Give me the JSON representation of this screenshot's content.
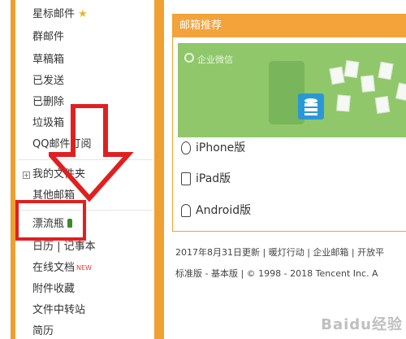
{
  "nav": {
    "items": [
      {
        "label": "星标邮件"
      },
      {
        "label": "群邮件"
      },
      {
        "label": "草稿箱"
      },
      {
        "label": "已发送"
      },
      {
        "label": "已删除"
      },
      {
        "label": "垃圾箱"
      },
      {
        "label": "QQ邮件订阅"
      },
      {
        "label": "我的文件夹"
      },
      {
        "label": "其他邮箱"
      },
      {
        "label": "漂流瓶"
      },
      {
        "label": "日历 | 记事本"
      },
      {
        "label": "在线文档",
        "badge": "NEW"
      },
      {
        "label": "附件收藏"
      },
      {
        "label": "文件中转站"
      },
      {
        "label": "简历"
      }
    ]
  },
  "panel": {
    "title": "邮箱推荐",
    "banner": {
      "title": "企业微信"
    },
    "platforms": [
      "iPhone版",
      "iPad版",
      "Android版"
    ]
  },
  "footer": {
    "line1": {
      "update": "2017年8月31日更新",
      "warm": "暖灯行动",
      "enterprise": "企业邮箱",
      "open": "开放平"
    },
    "line2": {
      "standard": "标准版",
      "basic": "基本版",
      "copyright": "© 1998 - 2018 Tencent Inc. A"
    }
  },
  "watermark": "Baidu经验",
  "colors": {
    "accent_orange": "#f0a030",
    "banner_green": "#8fc76a",
    "annotation_red": "#e02020"
  }
}
